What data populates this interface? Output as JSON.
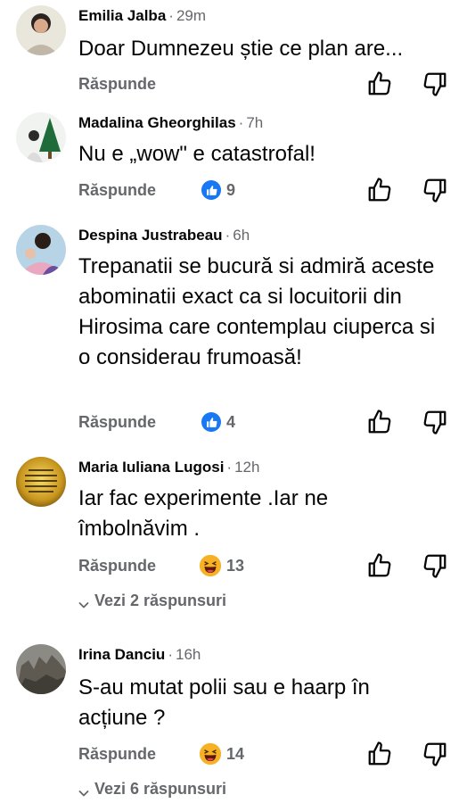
{
  "labels": {
    "reply": "Răspunde",
    "separator": "·"
  },
  "comments": [
    {
      "author": "Emilia Jalba",
      "time": "29m",
      "text": "Doar Dumnezeu știe ce plan are...",
      "reaction_type": null,
      "reaction_count": null,
      "replies_link": null
    },
    {
      "author": "Madalina Gheorghilas",
      "time": "7h",
      "text": "Nu e „wow\" e catastrofal!",
      "reaction_type": "like",
      "reaction_count": "9",
      "replies_link": null
    },
    {
      "author": "Despina Justrabeau",
      "time": "6h",
      "text": "Trepanatii se bucură si admiră aceste abominatii exact ca si locuitorii din Hirosima care contemplau ciuperca si o considerau frumoasă!",
      "reaction_type": "like",
      "reaction_count": "4",
      "replies_link": null
    },
    {
      "author": "Maria Iuliana Lugosi",
      "time": "12h",
      "text": "Iar fac experimente .Iar ne îmbolnăvim .",
      "reaction_type": "haha",
      "reaction_count": "13",
      "replies_link": "Vezi 2 răspunsuri"
    },
    {
      "author": "Irina Danciu",
      "time": "16h",
      "text": "S-au mutat polii sau e haarp în acțiune ?",
      "reaction_type": "haha",
      "reaction_count": "14",
      "replies_link": "Vezi 6 răspunsuri"
    }
  ],
  "colors": {
    "secondary_text": "#65676b",
    "like_blue": "#1877f2",
    "haha_yellow": "#f7b125"
  }
}
